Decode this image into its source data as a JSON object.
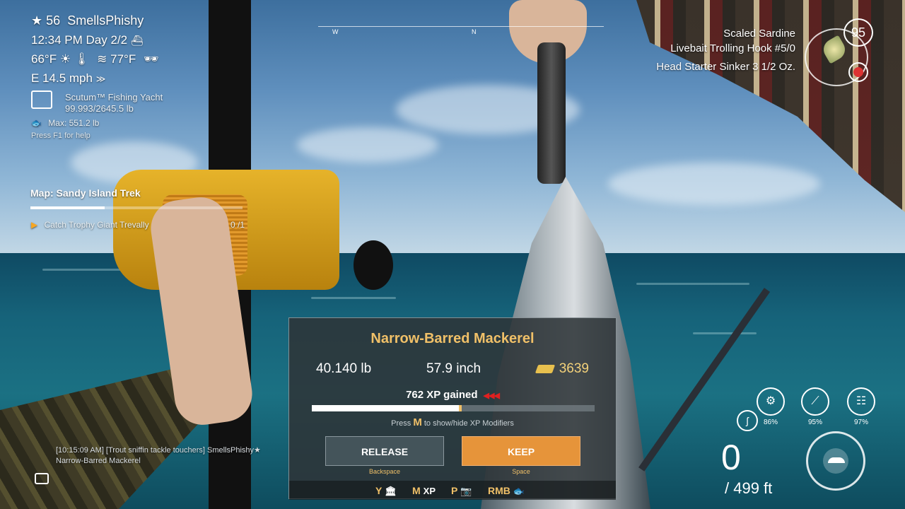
{
  "player": {
    "level": "56",
    "name": "SmellsPhishy",
    "time": "12:34 PM",
    "day": "Day 2/2",
    "air_temp": "66°F",
    "water_temp": "77°F",
    "wind": "E 14.5 mph"
  },
  "boat": {
    "name": "Scutum™ Fishing Yacht",
    "capacity": "99.993/2645.5 lb",
    "max": "Max: 551.2 lb"
  },
  "help_text": "Press F1 for help",
  "map": {
    "title": "Map: Sandy Island Trek",
    "progress": 0.35,
    "task": "Catch Trophy Giant Trevally",
    "task_count": "0 /1"
  },
  "compass": {
    "west": "W",
    "north": "N"
  },
  "tackle": {
    "bait": "Scaled Sardine",
    "hook": "Livebait Trolling Hook #5/0",
    "sinker": "Head Starter Sinker 3 1/2 Oz.",
    "bait_count": "95"
  },
  "gauges": [
    {
      "pct": "86%"
    },
    {
      "pct": "95%"
    },
    {
      "pct": "97%"
    }
  ],
  "line": {
    "current": "0",
    "max": "/ 499 ft"
  },
  "chat": {
    "line1": "[10:15:09 AM] [Trout sniffin tackle touchers] SmellsPhishy★",
    "line2": "Narrow-Barred Mackerel"
  },
  "catch": {
    "fish_name": "Narrow-Barred Mackerel",
    "weight": "40.140 lb",
    "length": "57.9 inch",
    "money": "3639",
    "xp_text": "762 XP gained",
    "xp_progress": 0.52,
    "press_prefix": "Press",
    "press_key": "M",
    "press_suffix": "to show/hide XP Modifiers",
    "release_label": "RELEASE",
    "release_key": "Backspace",
    "keep_label": "KEEP",
    "keep_key": "Space"
  },
  "bottom_keys": [
    {
      "key": "Y",
      "icon": "🏛"
    },
    {
      "key": "M",
      "icon": "XP"
    },
    {
      "key": "P",
      "icon": "📷"
    },
    {
      "key": "RMB",
      "icon": "🐟"
    }
  ],
  "colors": {
    "accent": "#f0c068",
    "keep_button": "#e6943a",
    "release_button": "#46555c"
  }
}
